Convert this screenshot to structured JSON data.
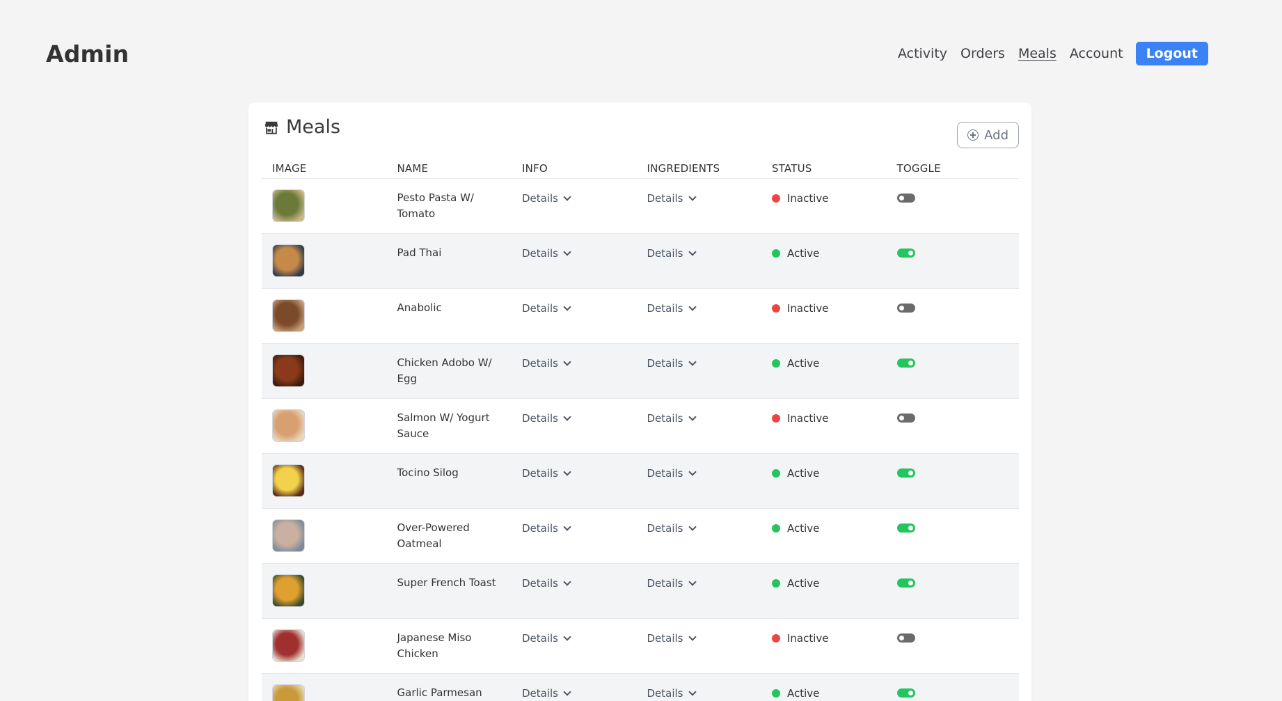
{
  "brand": "Admin",
  "nav": {
    "items": [
      "Activity",
      "Orders",
      "Meals",
      "Account"
    ],
    "current": "Meals",
    "logout_label": "Logout"
  },
  "colors": {
    "accent": "#3b82f6",
    "active": "#22c55e",
    "inactive": "#ef4444",
    "toggle_off": "#6b6b6b"
  },
  "card": {
    "title": "Meals",
    "icon": "store-icon",
    "add_label": "Add"
  },
  "table": {
    "headers": [
      "IMAGE",
      "NAME",
      "INFO",
      "INGREDIENTS",
      "STATUS",
      "TOGGLE"
    ],
    "rows": [
      {
        "name": "Pesto Pasta W/ Tomato",
        "info": "Details",
        "ingredients": "Details",
        "status": "Inactive",
        "enabled": false,
        "thumb": [
          "#6b7a3a",
          "#c9b98a"
        ]
      },
      {
        "name": "Pad Thai",
        "info": "Details",
        "ingredients": "Details",
        "status": "Active",
        "enabled": true,
        "thumb": [
          "#c58a4a",
          "#2f3a4a"
        ]
      },
      {
        "name": "Anabolic",
        "info": "Details",
        "ingredients": "Details",
        "status": "Inactive",
        "enabled": false,
        "thumb": [
          "#7a4a2a",
          "#c9a07a"
        ]
      },
      {
        "name": "Chicken Adobo W/ Egg",
        "info": "Details",
        "ingredients": "Details",
        "status": "Active",
        "enabled": true,
        "thumb": [
          "#8a3a1a",
          "#3a1a0a"
        ]
      },
      {
        "name": "Salmon W/ Yogurt Sauce",
        "info": "Details",
        "ingredients": "Details",
        "status": "Inactive",
        "enabled": false,
        "thumb": [
          "#d8a070",
          "#e8d8c0"
        ]
      },
      {
        "name": "Tocino Silog",
        "info": "Details",
        "ingredients": "Details",
        "status": "Active",
        "enabled": true,
        "thumb": [
          "#f2d24a",
          "#5a2a1a"
        ]
      },
      {
        "name": "Over-Powered Oatmeal",
        "info": "Details",
        "ingredients": "Details",
        "status": "Active",
        "enabled": true,
        "thumb": [
          "#c9b0a0",
          "#7a8a9a"
        ]
      },
      {
        "name": "Super French Toast",
        "info": "Details",
        "ingredients": "Details",
        "status": "Active",
        "enabled": true,
        "thumb": [
          "#e0a030",
          "#3a4a2a"
        ]
      },
      {
        "name": "Japanese Miso Chicken",
        "info": "Details",
        "ingredients": "Details",
        "status": "Inactive",
        "enabled": false,
        "thumb": [
          "#a03030",
          "#e8e0d0"
        ]
      },
      {
        "name": "Garlic Parmesan Wings",
        "info": "Details",
        "ingredients": "Details",
        "status": "Active",
        "enabled": true,
        "thumb": [
          "#c89a3a",
          "#e8d8b0"
        ]
      }
    ]
  }
}
